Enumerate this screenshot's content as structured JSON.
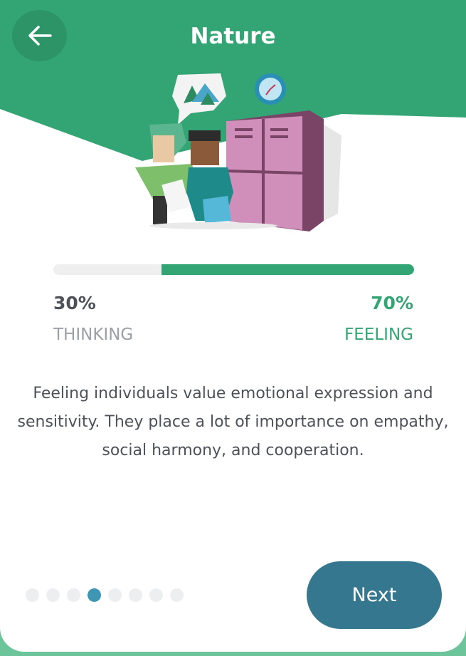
{
  "header": {
    "title": "Nature"
  },
  "progress": {
    "left_label": "THINKING",
    "left_percent": "30%",
    "right_label": "FEELING",
    "right_percent": "70%",
    "fill_fraction": 0.7
  },
  "description": "Feeling individuals value emotional expression and sensitivity. They place a lot of importance on empathy, social harmony, and cooperation.",
  "pagination": {
    "total": 8,
    "active_index": 3
  },
  "buttons": {
    "next": "Next"
  },
  "colors": {
    "brand_green": "#33a474",
    "muted": "#9aa0a6",
    "dark": "#4d5258",
    "button": "#35778e",
    "active_dot": "#3f96b4"
  }
}
